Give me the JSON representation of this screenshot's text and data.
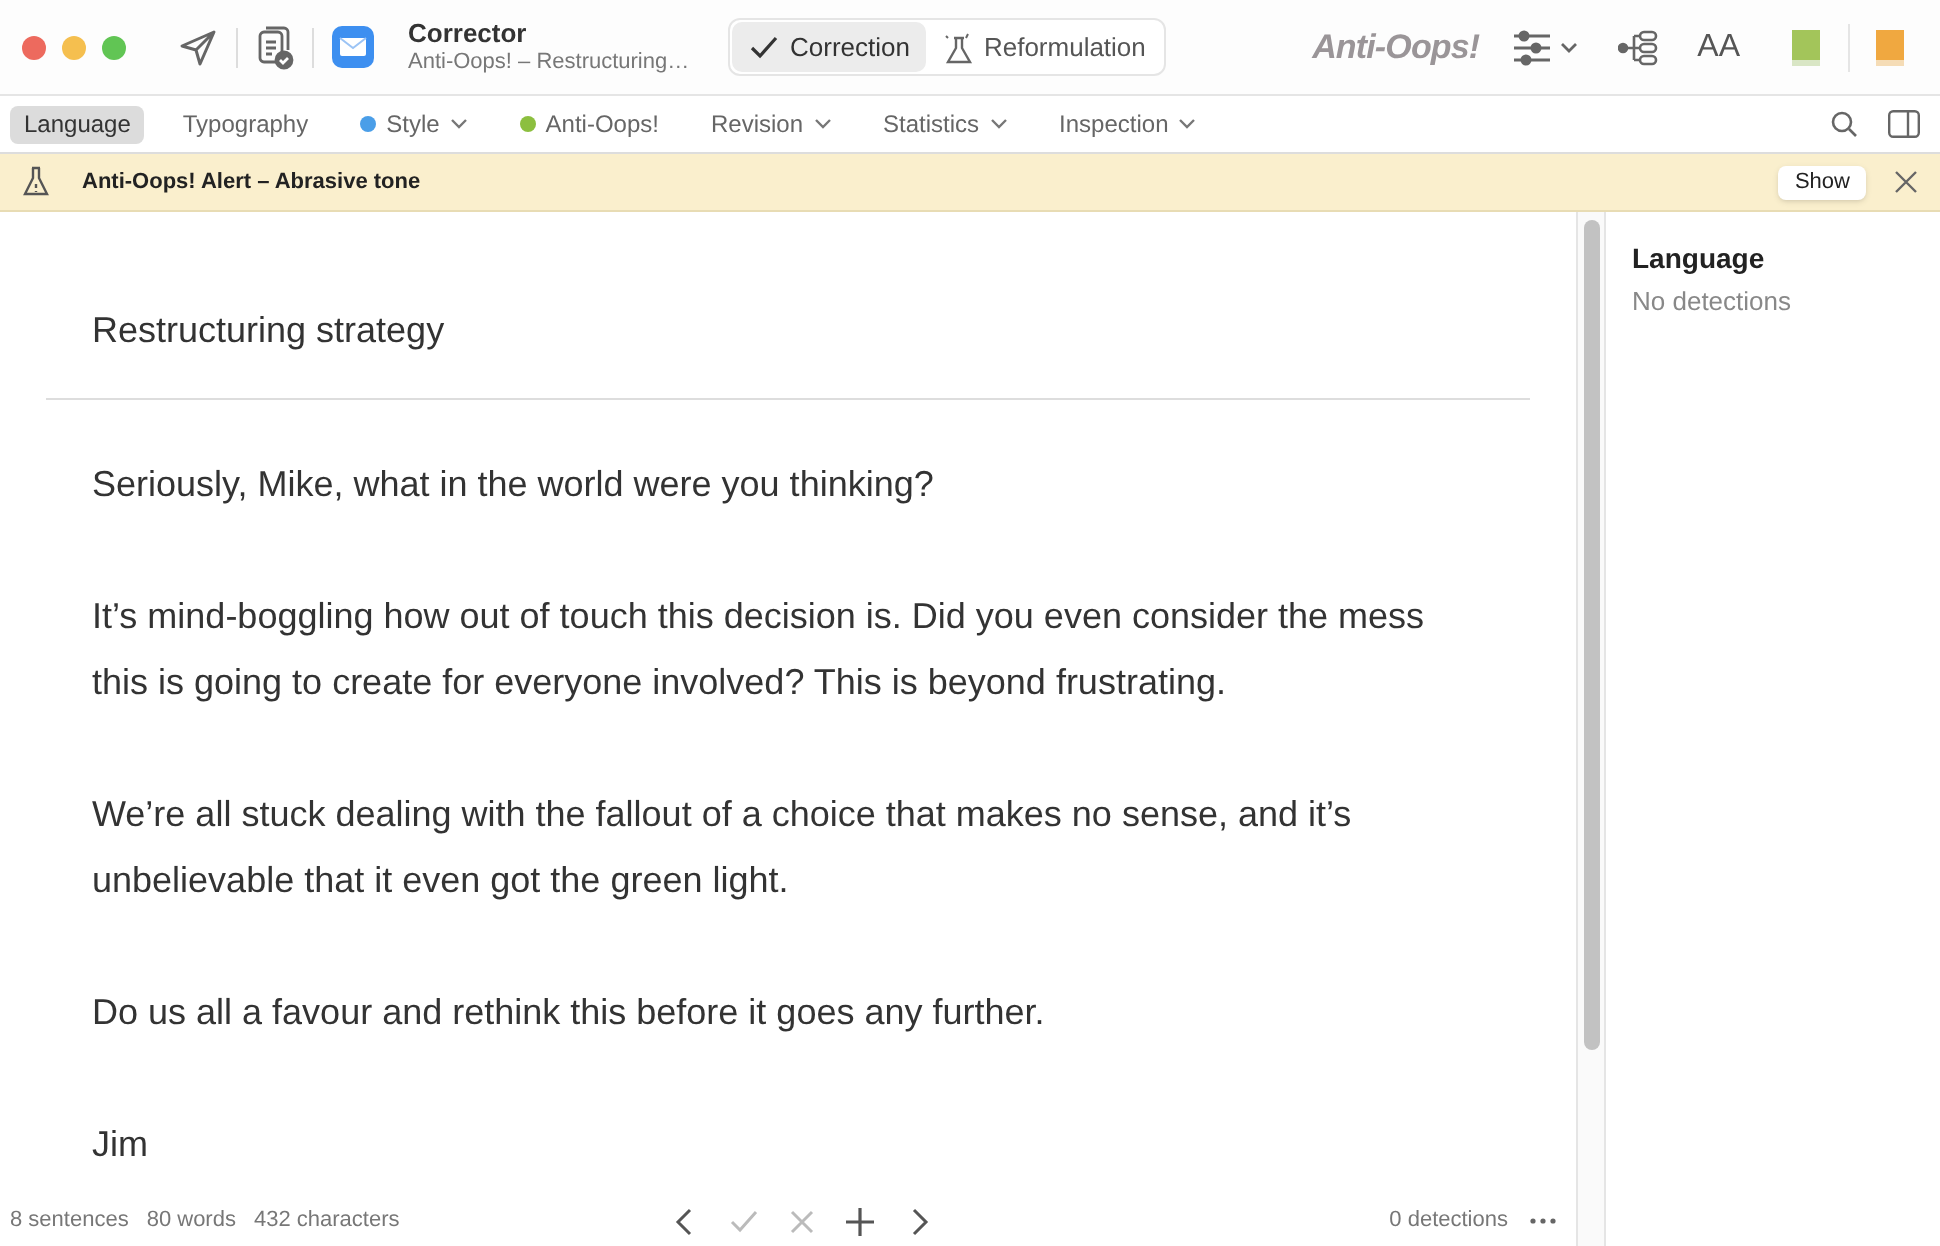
{
  "window": {
    "title": "Corrector",
    "subtitle": "Anti-Oops! – Restructuring…"
  },
  "modes": [
    {
      "label": "Correction",
      "kind": "check",
      "selected": true
    },
    {
      "label": "Reformulation",
      "kind": "flask",
      "selected": false
    }
  ],
  "brand": "Anti-Oops!",
  "aa": "AA",
  "tabs": [
    {
      "label": "Language",
      "selected": true
    },
    {
      "label": "Typography",
      "selected": false
    },
    {
      "label": "Style",
      "selected": false,
      "color": "#4a9ee8",
      "dropdown": true
    },
    {
      "label": "Anti-Oops!",
      "selected": false,
      "color": "#8cbf3f"
    },
    {
      "label": "Revision",
      "selected": false,
      "dropdown": true
    },
    {
      "label": "Statistics",
      "selected": false,
      "dropdown": true
    },
    {
      "label": "Inspection",
      "selected": false,
      "dropdown": true
    }
  ],
  "alert": {
    "text": "Anti-Oops! Alert – Abrasive tone",
    "button": "Show"
  },
  "document": {
    "title": "Restructuring strategy",
    "paragraphs": [
      "Seriously, Mike, what in the world were you thinking?",
      "It’s mind-boggling how out of touch this decision is. Did you even consider the mess this is going to create for everyone involved? This is beyond frustrating.",
      "We’re all stuck dealing with the fallout of a choice that makes no sense, and it’s unbelievable that it even got the green light.",
      "Do us all a favour and rethink this before it goes any further.",
      "Jim"
    ]
  },
  "status_bar": {
    "stats": [
      "8 sentences",
      "80 words",
      "432 characters"
    ],
    "detections": "0 detections",
    "actions": [
      {
        "kind": "prev",
        "disabled": false
      },
      {
        "kind": "accept",
        "disabled": true
      },
      {
        "kind": "reject",
        "disabled": true
      },
      {
        "kind": "add",
        "disabled": false
      },
      {
        "kind": "next",
        "disabled": false
      }
    ]
  },
  "side_panel": {
    "title": "Language",
    "text": "No detections"
  }
}
